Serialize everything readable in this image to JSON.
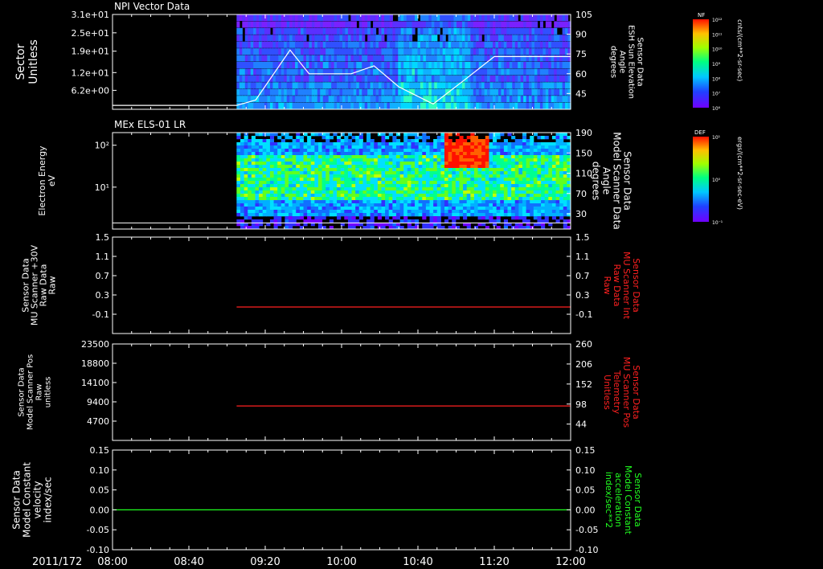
{
  "time_axis": {
    "date_label": "2011/172",
    "ticks": [
      "08:00",
      "08:40",
      "09:20",
      "10:00",
      "10:40",
      "11:20",
      "12:00"
    ],
    "range": [
      "08:00",
      "12:00"
    ]
  },
  "colors": {
    "background": "#000000",
    "axis": "#ffffff",
    "red_trace": "#ff2020",
    "green_trace": "#20ff20"
  },
  "chart_data": [
    {
      "type": "heatmap",
      "title": "NPI Vector Data",
      "ylabel": "Sector\nUnitless",
      "ylim": [
        0,
        31
      ],
      "y_ticks": [
        "3.1e+01",
        "2.5e+01",
        "1.9e+01",
        "1.2e+01",
        "6.2e+00"
      ],
      "y_tick_values": [
        31,
        25,
        19,
        12,
        6.2
      ],
      "right_ylabel": "Sensor Data\nESH Sun Elevation\nAngle\ndegrees",
      "right_ticks": [
        "105",
        "90",
        "75",
        "60",
        "45"
      ],
      "right_tick_values": [
        105,
        90,
        75,
        60,
        45
      ],
      "right_ylim": [
        33,
        105
      ],
      "data_start": "09:05",
      "overlay_series": {
        "name": "ESH Sun Elevation Angle",
        "x": [
          "08:00",
          "09:05",
          "09:15",
          "09:33",
          "09:43",
          "10:05",
          "10:17",
          "10:30",
          "10:48",
          "11:05",
          "11:20",
          "12:00"
        ],
        "y": [
          36,
          36,
          40,
          78,
          60,
          60,
          66,
          50,
          37,
          56,
          73,
          73
        ]
      },
      "colorbar": {
        "label": "NF",
        "units": "cnts/(cm**2-sr-sec)",
        "ticks": [
          "10¹²",
          "10¹¹",
          "10¹⁰",
          "10⁹",
          "10⁸",
          "10⁷",
          "10⁶"
        ]
      }
    },
    {
      "type": "heatmap",
      "title": "MEx ELS-01 LR",
      "ylabel": "Electron Energy\neV",
      "yscale": "log",
      "ylim": [
        1,
        200
      ],
      "y_ticks": [
        "10²",
        "10¹"
      ],
      "y_tick_values": [
        100,
        10
      ],
      "right_ylabel": "Sensor Data\nModel Scanner Data\nAngle\ndegrees",
      "right_ticks": [
        "190",
        "150",
        "110",
        "70",
        "30"
      ],
      "right_tick_values": [
        190,
        150,
        110,
        70,
        30
      ],
      "right_ylim": [
        0,
        190
      ],
      "data_start": "09:05",
      "overlay_series": {
        "name": "Model Scanner Angle",
        "x": [
          "08:00",
          "12:00"
        ],
        "y": [
          12,
          12
        ]
      },
      "colorbar": {
        "label": "DEF",
        "units": "ergs/(cm**2-sr-sec-eV)",
        "ticks": [
          "10¹",
          "10⁰",
          "10⁻¹"
        ]
      }
    },
    {
      "type": "line",
      "title": "",
      "ylabel": "Sensor Data\nMU Scanner +30V\nRaw Data\nRaw",
      "y_ticks": [
        "1.5",
        "1.1",
        "0.7",
        "0.3",
        "-0.1"
      ],
      "ylim": [
        -0.5,
        1.5
      ],
      "right_ylabel": "Sensor Data\nMU Scanner Int\nRaw Data\nRaw",
      "right_ticks": [
        "1.5",
        "1.1",
        "0.7",
        "0.3",
        "-0.1"
      ],
      "right_ylim": [
        -0.5,
        1.5
      ],
      "series": [
        {
          "name": "MU Scanner Int Raw Data",
          "color": "#ff2020",
          "x": [
            "09:05",
            "12:00"
          ],
          "y": [
            0.05,
            0.05
          ]
        }
      ]
    },
    {
      "type": "line",
      "title": "",
      "ylabel": "Sensor Data\nModel Scanner Pos\nRaw\nunitless",
      "y_ticks": [
        "23500",
        "18800",
        "14100",
        "9400",
        "4700"
      ],
      "ylim": [
        0,
        23500
      ],
      "right_ylabel": "Sensor Data\nMU Scanner Pos\nTelemetry\nUnitless",
      "right_ticks": [
        "260",
        "206",
        "152",
        "98",
        "44"
      ],
      "right_ylim": [
        0,
        260
      ],
      "series": [
        {
          "name": "MU Scanner Pos Telemetry",
          "color": "#ff2020",
          "x": [
            "09:05",
            "12:00"
          ],
          "y": [
            8400,
            8400
          ]
        }
      ]
    },
    {
      "type": "line",
      "title": "",
      "ylabel": "Sensor Data\nModel Constant\nvelocity\nindex/sec",
      "y_ticks": [
        "0.15",
        "0.10",
        "0.05",
        "0.00",
        "-0.05",
        "-0.10"
      ],
      "ylim": [
        -0.1,
        0.15
      ],
      "right_ylabel": "Sensor Data\nModel Constant\nacceleration\nindex/sec**2",
      "right_ticks": [
        "0.15",
        "0.10",
        "0.05",
        "0.00",
        "-0.05",
        "-0.10"
      ],
      "right_ylim": [
        -0.1,
        0.15
      ],
      "series": [
        {
          "name": "Model Constant acceleration",
          "color": "#20ff20",
          "x": [
            "08:00",
            "12:00"
          ],
          "y": [
            0.0,
            0.0
          ]
        }
      ]
    }
  ]
}
